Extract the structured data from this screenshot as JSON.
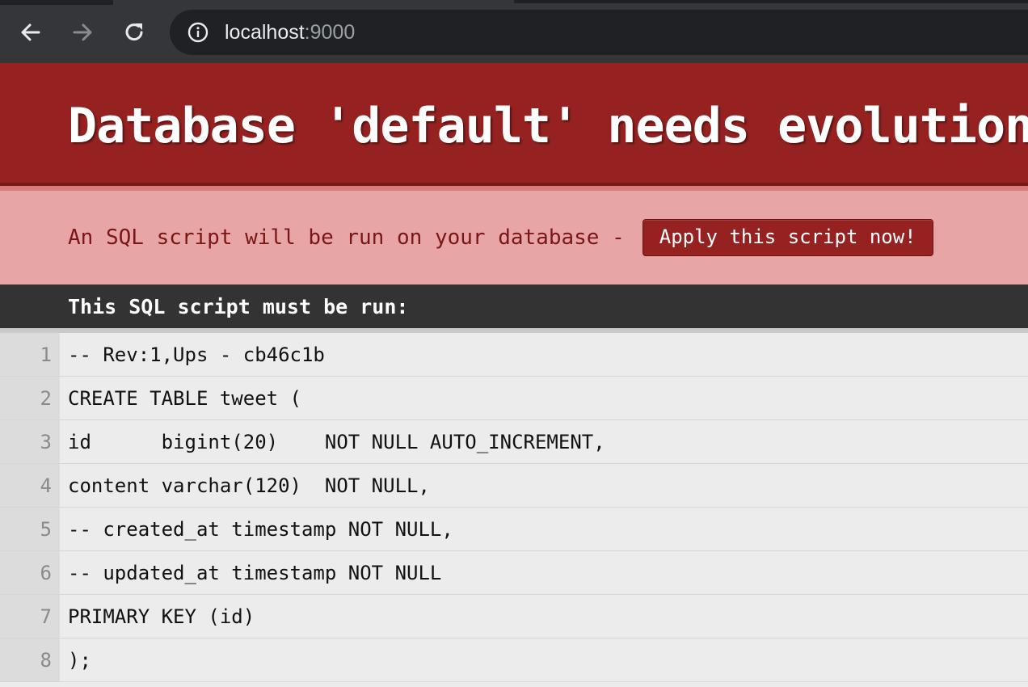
{
  "browser": {
    "url_host": "localhost",
    "url_port": ":9000",
    "icons": [
      "back-arrow-icon",
      "forward-arrow-icon",
      "reload-icon",
      "info-icon"
    ]
  },
  "page": {
    "title": "Database 'default' needs evolution!",
    "subtitle": "An SQL script will be run on your database -",
    "apply_button": "Apply this script now!",
    "script_label": "This SQL script must be run:",
    "colors": {
      "header": "#962121",
      "subheader": "#e8a5a5",
      "label_bar": "#333333",
      "code_bg": "#ececec"
    }
  },
  "script": {
    "lines": [
      {
        "no": "1",
        "code": "-- Rev:1,Ups - cb46c1b"
      },
      {
        "no": "2",
        "code": "CREATE TABLE tweet ("
      },
      {
        "no": "3",
        "code": "id      bigint(20)    NOT NULL AUTO_INCREMENT,"
      },
      {
        "no": "4",
        "code": "content varchar(120)  NOT NULL,"
      },
      {
        "no": "5",
        "code": "-- created_at timestamp NOT NULL,"
      },
      {
        "no": "6",
        "code": "-- updated_at timestamp NOT NULL"
      },
      {
        "no": "7",
        "code": "PRIMARY KEY (id)"
      },
      {
        "no": "8",
        "code": ");"
      }
    ]
  }
}
